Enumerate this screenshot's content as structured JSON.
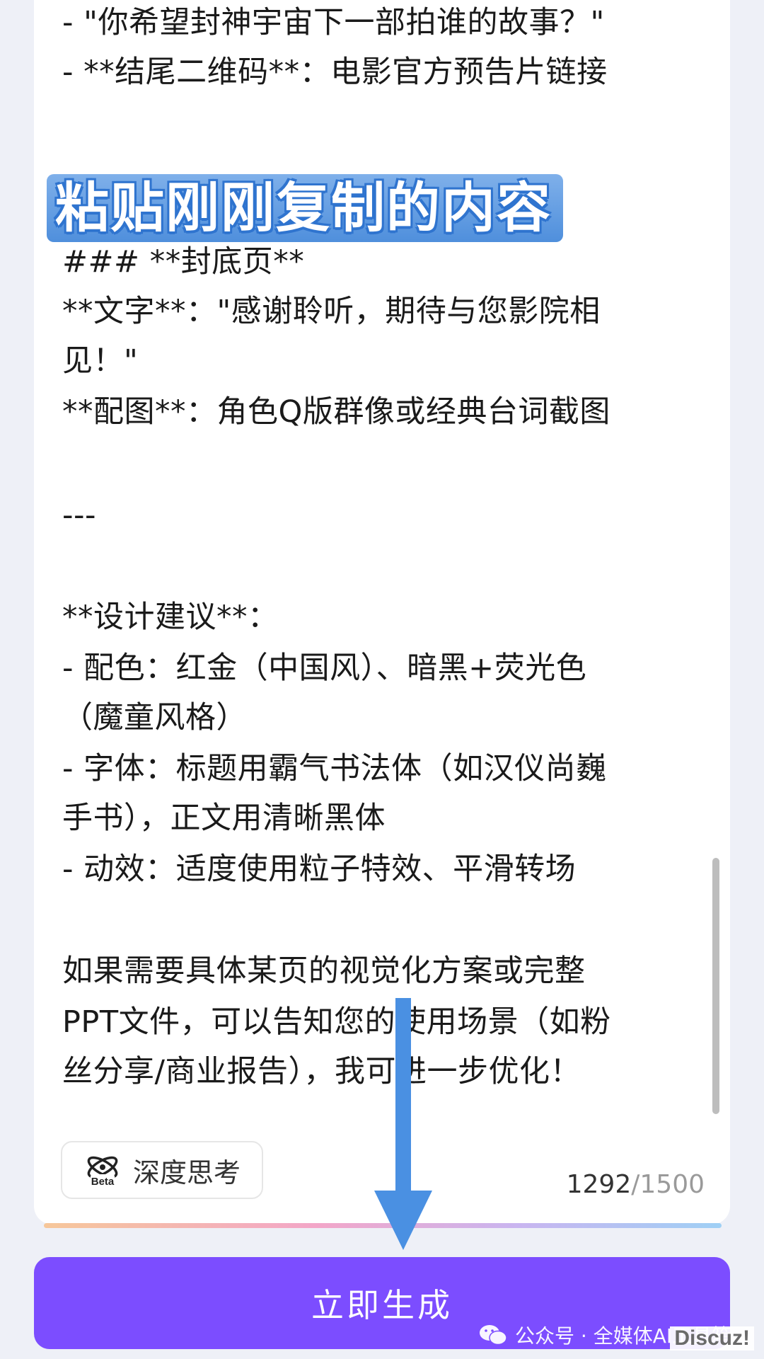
{
  "content": {
    "lines_top": [
      "  - \"你希望封神宇宙下一部拍谁的故事？\"",
      "- **结尾二维码**：电影官方预告片链接"
    ],
    "annotation": "粘贴刚刚复制的内容",
    "lines_main": [
      "### **封底页**",
      "**文字**：\"感谢聆听，期待与您影院相",
      "见！\"",
      "**配图**：角色Q版群像或经典台词截图",
      "---",
      "**设计建议**：",
      "- 配色：红金（中国风）、暗黑+荧光色",
      "（魔童风格）",
      "- 字体：标题用霸气书法体（如汉仪尚巍",
      "手书），正文用清晰黑体",
      "- 动效：适度使用粒子特效、平滑转场",
      "如果需要具体某页的视觉化方案或完整",
      "PPT文件，可以告知您的使用场景（如粉",
      "丝分享/商业报告），我可进一步优化！"
    ]
  },
  "think_button": {
    "label": "深度思考",
    "badge": "Beta"
  },
  "counter": {
    "current": "1292",
    "max": "/1500"
  },
  "generate_button": {
    "label": "立即生成"
  },
  "watermark": {
    "text": "公众号 · 全媒体AI工具箱"
  },
  "site_tag": "Discuz!",
  "colors": {
    "accent": "#7c4dff",
    "annotation": "#4f8fdc",
    "arrow": "#4a90e2"
  }
}
